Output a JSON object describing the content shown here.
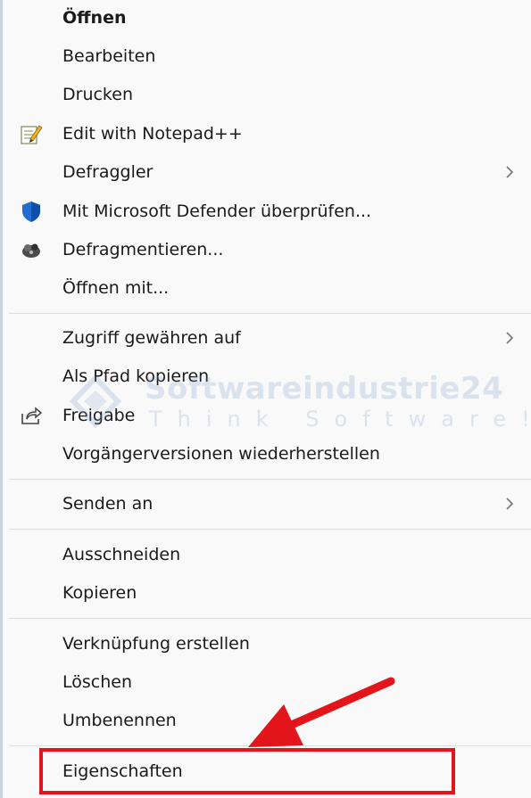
{
  "menu": {
    "items": [
      {
        "label": "Öffnen"
      },
      {
        "label": "Bearbeiten"
      },
      {
        "label": "Drucken"
      },
      {
        "label": "Edit with Notepad++",
        "icon": "notepad-plus-plus-icon"
      },
      {
        "label": "Defraggler",
        "submenu": true
      },
      {
        "label": "Mit Microsoft Defender überprüfen...",
        "icon": "defender-shield-icon"
      },
      {
        "label": "Defragmentieren...",
        "icon": "defrag-icon"
      },
      {
        "label": "Öffnen mit..."
      },
      {
        "label": "Zugriff gewähren auf",
        "submenu": true
      },
      {
        "label": "Als Pfad kopieren"
      },
      {
        "label": "Freigabe",
        "icon": "share-icon"
      },
      {
        "label": "Vorgängerversionen wiederherstellen"
      },
      {
        "label": "Senden an",
        "submenu": true
      },
      {
        "label": "Ausschneiden"
      },
      {
        "label": "Kopieren"
      },
      {
        "label": "Verknüpfung erstellen"
      },
      {
        "label": "Löschen"
      },
      {
        "label": "Umbenennen"
      },
      {
        "label": "Eigenschaften"
      }
    ]
  },
  "watermark": {
    "brand": "Softwareindustrie24",
    "tagline": "Think Software!"
  },
  "colors": {
    "highlight": "#e3141a",
    "menu_background": "#f9f9f9",
    "separator": "#dcdcdc"
  }
}
